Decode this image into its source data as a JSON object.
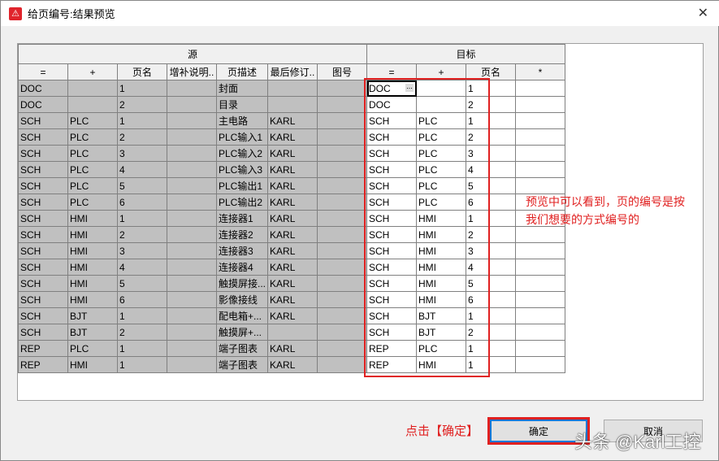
{
  "window": {
    "title": "给页编号:结果预览",
    "close": "✕",
    "icon": "warning-logo"
  },
  "groups": {
    "source": "源",
    "target": "目标"
  },
  "source_headers": [
    "=",
    "+",
    "页名",
    "增补说明..",
    "页描述",
    "最后修订..",
    "图号"
  ],
  "target_headers": [
    "=",
    "+",
    "页名",
    "*"
  ],
  "rows": [
    {
      "s": [
        "DOC",
        "",
        "1",
        "",
        "封面",
        "",
        ""
      ],
      "t": [
        "DOC",
        "",
        "1",
        ""
      ]
    },
    {
      "s": [
        "DOC",
        "",
        "2",
        "",
        "目录",
        "",
        ""
      ],
      "t": [
        "DOC",
        "",
        "2",
        ""
      ]
    },
    {
      "s": [
        "SCH",
        "PLC",
        "1",
        "",
        "主电路",
        "KARL",
        ""
      ],
      "t": [
        "SCH",
        "PLC",
        "1",
        ""
      ]
    },
    {
      "s": [
        "SCH",
        "PLC",
        "2",
        "",
        "PLC输入1",
        "KARL",
        ""
      ],
      "t": [
        "SCH",
        "PLC",
        "2",
        ""
      ]
    },
    {
      "s": [
        "SCH",
        "PLC",
        "3",
        "",
        "PLC输入2",
        "KARL",
        ""
      ],
      "t": [
        "SCH",
        "PLC",
        "3",
        ""
      ]
    },
    {
      "s": [
        "SCH",
        "PLC",
        "4",
        "",
        "PLC输入3",
        "KARL",
        ""
      ],
      "t": [
        "SCH",
        "PLC",
        "4",
        ""
      ]
    },
    {
      "s": [
        "SCH",
        "PLC",
        "5",
        "",
        "PLC输出1",
        "KARL",
        ""
      ],
      "t": [
        "SCH",
        "PLC",
        "5",
        ""
      ]
    },
    {
      "s": [
        "SCH",
        "PLC",
        "6",
        "",
        "PLC输出2",
        "KARL",
        ""
      ],
      "t": [
        "SCH",
        "PLC",
        "6",
        ""
      ]
    },
    {
      "s": [
        "SCH",
        "HMI",
        "1",
        "",
        "连接器1",
        "KARL",
        ""
      ],
      "t": [
        "SCH",
        "HMI",
        "1",
        ""
      ]
    },
    {
      "s": [
        "SCH",
        "HMI",
        "2",
        "",
        "连接器2",
        "KARL",
        ""
      ],
      "t": [
        "SCH",
        "HMI",
        "2",
        ""
      ]
    },
    {
      "s": [
        "SCH",
        "HMI",
        "3",
        "",
        "连接器3",
        "KARL",
        ""
      ],
      "t": [
        "SCH",
        "HMI",
        "3",
        ""
      ]
    },
    {
      "s": [
        "SCH",
        "HMI",
        "4",
        "",
        "连接器4",
        "KARL",
        ""
      ],
      "t": [
        "SCH",
        "HMI",
        "4",
        ""
      ]
    },
    {
      "s": [
        "SCH",
        "HMI",
        "5",
        "",
        "触摸屏接...",
        "KARL",
        ""
      ],
      "t": [
        "SCH",
        "HMI",
        "5",
        ""
      ]
    },
    {
      "s": [
        "SCH",
        "HMI",
        "6",
        "",
        "影像接线",
        "KARL",
        ""
      ],
      "t": [
        "SCH",
        "HMI",
        "6",
        ""
      ]
    },
    {
      "s": [
        "SCH",
        "BJT",
        "1",
        "",
        "配电箱+...",
        "KARL",
        ""
      ],
      "t": [
        "SCH",
        "BJT",
        "1",
        ""
      ]
    },
    {
      "s": [
        "SCH",
        "BJT",
        "2",
        "",
        "触摸屏+...",
        "",
        ""
      ],
      "t": [
        "SCH",
        "BJT",
        "2",
        ""
      ]
    },
    {
      "s": [
        "REP",
        "PLC",
        "1",
        "",
        "端子图表",
        "KARL",
        ""
      ],
      "t": [
        "REP",
        "PLC",
        "1",
        ""
      ]
    },
    {
      "s": [
        "REP",
        "HMI",
        "1",
        "",
        "端子图表",
        "KARL",
        ""
      ],
      "t": [
        "REP",
        "HMI",
        "1",
        ""
      ]
    }
  ],
  "annotation": {
    "note_line1": "预览中可以看到，页的编号是按",
    "note_line2": "我们想要的方式编号的",
    "click": "点击【确定】"
  },
  "buttons": {
    "ok": "确定",
    "cancel": "取消"
  },
  "watermark": "头条 @Karl工控"
}
